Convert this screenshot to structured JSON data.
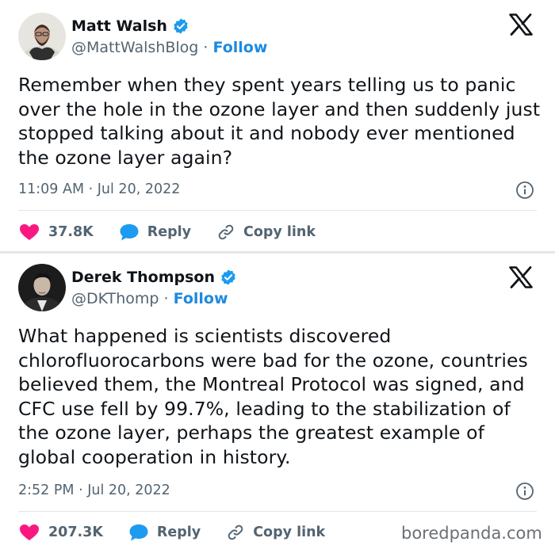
{
  "tweets": [
    {
      "display_name": "Matt Walsh",
      "handle": "@MattWalshBlog",
      "separator": "·",
      "follow_label": "Follow",
      "text": "Remember when they spent years telling us to panic over the hole in the ozone layer and then suddenly just stopped talking about it and nobody ever mentioned the ozone layer again?",
      "timestamp": "11:09 AM · Jul 20, 2022",
      "likes": "37.8K",
      "reply_label": "Reply",
      "copy_link_label": "Copy link",
      "icons": [
        "avatar",
        "verified-badge-icon",
        "x-logo-icon",
        "info-icon",
        "heart-icon",
        "reply-bubble-icon",
        "link-icon"
      ]
    },
    {
      "display_name": "Derek Thompson",
      "handle": "@DKThomp",
      "separator": "·",
      "follow_label": "Follow",
      "text": "What happened is scientists discovered chlorofluorocarbons were bad for the ozone, countries believed them, the Montreal Protocol was signed, and CFC use fell by 99.7%, leading to the stabilization of the ozone layer, perhaps the greatest example of global cooperation in history.",
      "timestamp": "2:52 PM · Jul 20, 2022",
      "likes": "207.3K",
      "reply_label": "Reply",
      "copy_link_label": "Copy link",
      "icons": [
        "avatar",
        "verified-badge-icon",
        "x-logo-icon",
        "info-icon",
        "heart-icon",
        "reply-bubble-icon",
        "link-icon"
      ]
    }
  ],
  "watermark": "boredpanda.com",
  "colors": {
    "follow": "#1d8ae0",
    "verified": "#1d9bf0",
    "heart": "#f91880",
    "reply_bubble": "#1d9bf0",
    "muted_text": "#536471",
    "divider": "#e3e6ea"
  }
}
